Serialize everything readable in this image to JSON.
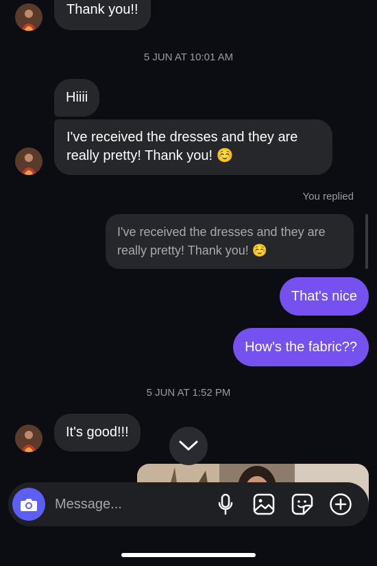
{
  "messages": {
    "thanks": "Thank you!!",
    "hiii": "Hiiii",
    "received": "I've received the dresses and they are really pretty! Thank you! ☺️",
    "reply_quote": "I've received the dresses and they are really pretty! Thank you! ☺️",
    "thats_nice": "That's nice",
    "fabric": "How's the fabric??",
    "good": "It's good!!!"
  },
  "timestamps": {
    "first": "5 JUN AT 10:01 AM",
    "second": "5 JUN AT 1:52 PM"
  },
  "reply_label": "You replied",
  "composer": {
    "placeholder": "Message..."
  },
  "icons": {
    "camera": "camera-icon",
    "mic": "microphone-icon",
    "gallery": "image-icon",
    "sticker": "sticker-icon",
    "add": "plus-circle-icon",
    "scroll_down": "chevron-down-icon"
  },
  "colors": {
    "background": "#0b0d12",
    "incoming_bubble": "#26272b",
    "outgoing_bubble": "#7551f0",
    "camera_button": "#5b5ff5"
  }
}
